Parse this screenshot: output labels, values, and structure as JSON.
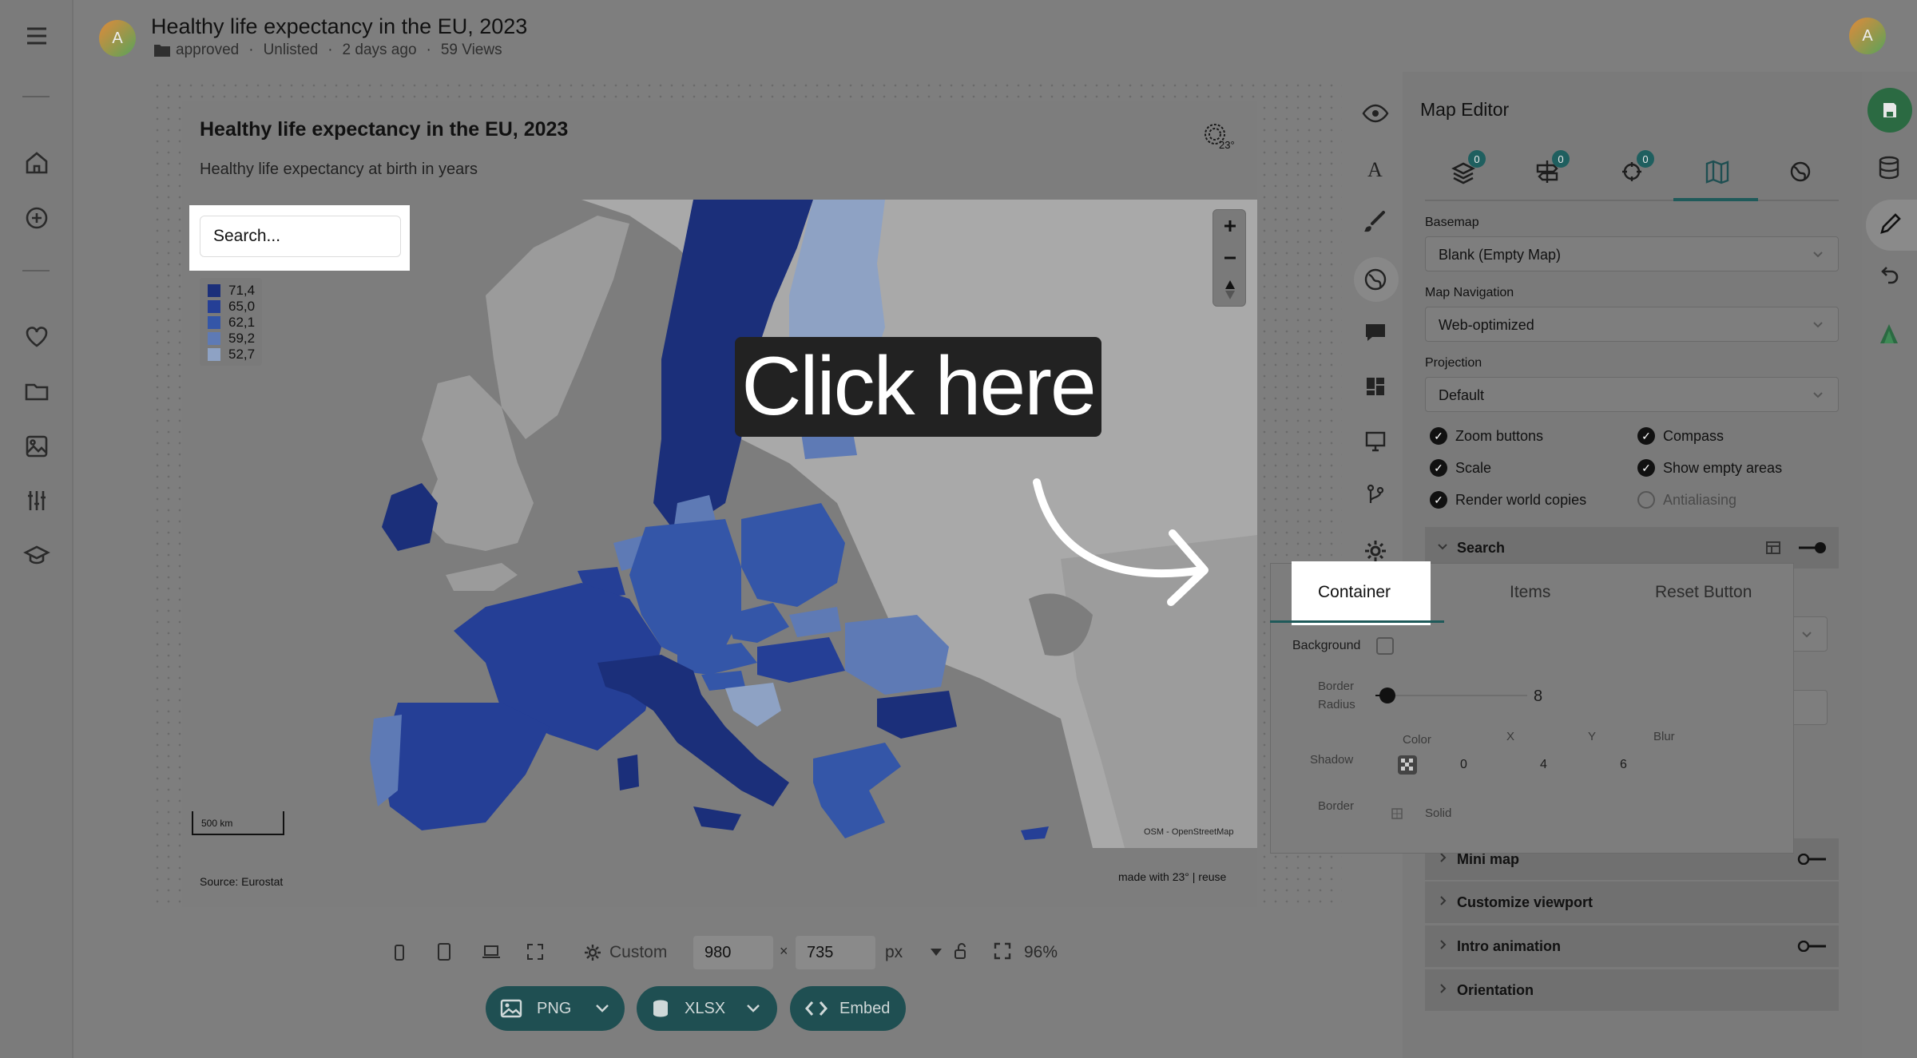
{
  "header": {
    "avatar_initial": "A",
    "title": "Healthy life expectancy in the EU, 2023",
    "folder": "approved",
    "visibility": "Unlisted",
    "time": "2 days ago",
    "views": "59 Views"
  },
  "map_card": {
    "title": "Healthy life expectancy in the EU, 2023",
    "subtitle": "Healthy life expectancy at birth in years",
    "search_placeholder": "Search...",
    "legend": [
      {
        "value": "71,4",
        "color": "#1b2f7a"
      },
      {
        "value": "65,0",
        "color": "#253f96"
      },
      {
        "value": "62,1",
        "color": "#3456a8"
      },
      {
        "value": "59,2",
        "color": "#5e7ab5"
      },
      {
        "value": "52,7",
        "color": "#8ea2c4"
      }
    ],
    "scale_label": "500 km",
    "attribution": "OSM - OpenStreetMap",
    "source": "Source: Eurostat",
    "made_with": "made with 23° | reuse",
    "logo_text": "23°"
  },
  "overlay": {
    "click_here": "Click here"
  },
  "editor": {
    "title": "Map Editor",
    "tabs": [
      {
        "icon": "layers-icon",
        "badge": "0"
      },
      {
        "icon": "signpost-icon",
        "badge": "0"
      },
      {
        "icon": "crosshair-icon",
        "badge": "0"
      },
      {
        "icon": "map-icon",
        "badge": ""
      },
      {
        "icon": "globe-icon",
        "badge": ""
      }
    ],
    "basemap_label": "Basemap",
    "basemap_value": "Blank (Empty Map)",
    "navigation_label": "Map Navigation",
    "navigation_value": "Web-optimized",
    "projection_label": "Projection",
    "projection_value": "Default",
    "checks": {
      "zoom_buttons": "Zoom buttons",
      "compass": "Compass",
      "scale": "Scale",
      "show_empty_areas": "Show empty areas",
      "render_world_copies": "Render world copies",
      "antialiasing": "Antialiasing"
    },
    "sections": {
      "search": "Search",
      "mini_map": "Mini map",
      "customize_viewport": "Customize viewport",
      "intro_animation": "Intro animation",
      "orientation": "Orientation"
    }
  },
  "popup": {
    "tabs": [
      "Container",
      "Items",
      "Reset Button"
    ],
    "background_label": "Background",
    "border_radius_label_1": "Border",
    "border_radius_label_2": "Radius",
    "border_radius_value": "8",
    "border_radius_fraction": 0.08,
    "shadow_label": "Shadow",
    "shadow_cols": {
      "color": "Color",
      "x": "X",
      "y": "Y",
      "blur": "Blur"
    },
    "shadow_x": "0",
    "shadow_y": "4",
    "shadow_blur": "6",
    "border_label": "Border",
    "border_style": "Solid"
  },
  "bottom": {
    "preset": "Custom",
    "width": "980",
    "times": "×",
    "height": "735",
    "unit": "px",
    "zoom": "96%",
    "png": "PNG",
    "xlsx": "XLSX",
    "embed": "Embed"
  },
  "colors": {
    "accent": "#1f4f52",
    "save_green": "#2b6a42",
    "tier1": "#1b2f7a",
    "tier2": "#253f96",
    "tier3": "#3456a8",
    "tier4": "#5e7ab5",
    "tier5": "#8ea2c4",
    "land": "#a9a9a9"
  }
}
